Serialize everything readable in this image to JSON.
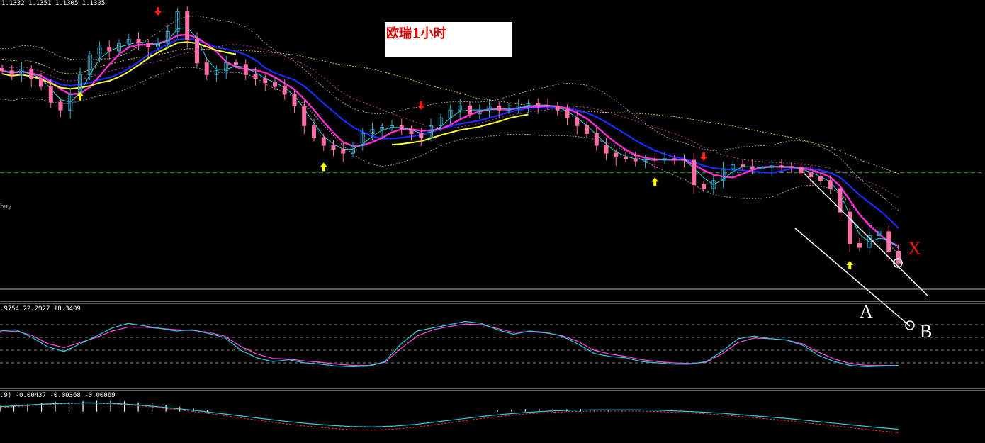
{
  "header": {
    "ohlc_readout": "1.1332 1.1351 1.1305 1.1305",
    "title": "欧瑞1小时",
    "buy_label": "buy"
  },
  "indicator1": {
    "readout": ".9754 22.2927 18.3409"
  },
  "indicator2": {
    "readout": ".9) -0.00437 -0.00368 -0.00069"
  },
  "annotations": {
    "A": "A",
    "B": "B",
    "X": "X"
  },
  "colors": {
    "background": "#000000",
    "bull_candle": "#2aa8c8",
    "bear_candle": "#ff6fa8",
    "ma_blue": "#1a2cff",
    "ma_magenta": "#ff2cd6",
    "ma_yellow": "#ffff33",
    "ma_cyan": "#22d6e8",
    "envelope": "#c8c8c8",
    "buy_line": "#22aa22",
    "up_arrow": "#ffff00",
    "down_arrow": "#ff1a1a",
    "stoch_main": "#2ad0e0",
    "stoch_signal": "#ff4ce0",
    "macd_hist": "#ffffff",
    "macd_signal": "#ff3030",
    "macd_line": "#2ad0e0"
  },
  "chart_data": [
    {
      "type": "candlestick",
      "title": "欧瑞1小时",
      "ylim": [
        1.127,
        1.164
      ],
      "horizontal_line": {
        "label": "buy",
        "value": 1.142
      },
      "series": [
        {
          "name": "price",
          "close": [
            1.155,
            1.1545,
            1.1552,
            1.154,
            1.153,
            1.151,
            1.15,
            1.152,
            1.1545,
            1.157,
            1.158,
            1.1575,
            1.1585,
            1.159,
            1.1585,
            1.158,
            1.1585,
            1.16,
            1.1625,
            1.159,
            1.156,
            1.1545,
            1.155,
            1.156,
            1.1558,
            1.1545,
            1.154,
            1.1535,
            1.153,
            1.152,
            1.1505,
            1.148,
            1.1465,
            1.1455,
            1.145,
            1.1445,
            1.1455,
            1.147,
            1.1475,
            1.1478,
            1.148,
            1.1475,
            1.147,
            1.1465,
            1.148,
            1.149,
            1.15,
            1.1505,
            1.1495,
            1.15,
            1.1505,
            1.15,
            1.1502,
            1.1505,
            1.1508,
            1.1506,
            1.1505,
            1.15,
            1.149,
            1.148,
            1.147,
            1.1455,
            1.1445,
            1.144,
            1.1438,
            1.1435,
            1.1437,
            1.1436,
            1.1438,
            1.1437,
            1.1436,
            1.1405,
            1.14,
            1.141,
            1.1425,
            1.143,
            1.1428,
            1.1425,
            1.1427,
            1.1429,
            1.1428,
            1.1427,
            1.142,
            1.1415,
            1.141,
            1.14,
            1.137,
            1.133,
            1.1325,
            1.134,
            1.1345,
            1.132,
            1.1305
          ]
        }
      ]
    },
    {
      "type": "line",
      "title": "",
      "ylim": [
        0,
        100
      ],
      "grid_levels": [
        80,
        60,
        40,
        20
      ],
      "series": [
        {
          "name": "",
          "values": [
            70,
            72,
            60,
            45,
            38,
            50,
            62,
            75,
            82,
            78,
            74,
            70,
            72,
            66,
            60,
            40,
            28,
            22,
            25,
            20,
            18,
            15,
            14,
            15,
            22,
            50,
            70,
            75,
            80,
            85,
            82,
            72,
            65,
            70,
            68,
            62,
            50,
            35,
            30,
            28,
            22,
            20,
            18,
            18,
            22,
            38,
            58,
            62,
            58,
            56,
            48,
            32,
            22,
            16,
            14,
            15,
            16
          ]
        },
        {
          "name": "",
          "values": [
            68,
            70,
            63,
            50,
            44,
            52,
            60,
            70,
            76,
            76,
            74,
            72,
            71,
            68,
            62,
            46,
            34,
            27,
            26,
            23,
            21,
            18,
            16,
            16,
            21,
            43,
            62,
            72,
            77,
            81,
            80,
            74,
            68,
            69,
            67,
            63,
            54,
            40,
            34,
            30,
            25,
            22,
            20,
            19,
            21,
            34,
            52,
            59,
            58,
            56,
            50,
            37,
            26,
            19,
            16,
            16,
            16
          ]
        }
      ]
    },
    {
      "type": "bar",
      "title": "",
      "ylim": [
        -0.006,
        0.003
      ],
      "series": [
        {
          "name": "histogram",
          "values": [
            0.0012,
            0.0014,
            0.0016,
            0.0018,
            0.002,
            0.002,
            0.0021,
            0.0022,
            0.0022,
            0.0021,
            0.0019,
            0.0017,
            0.0014,
            0.001,
            0.0006,
            0.0003,
            0.0,
            -0.0004,
            -0.0008,
            -0.0012,
            -0.0016,
            -0.002,
            -0.0024,
            -0.0026,
            -0.0028,
            -0.003,
            -0.0032,
            -0.0033,
            -0.0033,
            -0.0031,
            -0.0027,
            -0.0022,
            -0.0016,
            -0.001,
            -0.0005,
            -0.0001,
            0.0002,
            0.0004,
            0.0005,
            0.0006,
            0.0006,
            0.0005,
            0.0005,
            0.0004,
            0.0003,
            0.0002,
            0.0001,
            -0.0001,
            -0.0003,
            -0.0005,
            -0.0007,
            -0.001,
            -0.0013,
            -0.0016,
            -0.0018,
            -0.002,
            -0.0023,
            -0.0025,
            -0.0028,
            -0.0031,
            -0.0034,
            -0.0037,
            -0.004,
            -0.0042,
            -0.0043,
            -0.0044
          ]
        },
        {
          "name": "signal",
          "values": [
            0.0011,
            0.0014,
            0.0017,
            0.0019,
            0.002,
            0.0019,
            0.0016,
            0.0012,
            0.0007,
            0.0002,
            -0.0004,
            -0.001,
            -0.0016,
            -0.0022,
            -0.0027,
            -0.0031,
            -0.0034,
            -0.0035,
            -0.0033,
            -0.0029,
            -0.0023,
            -0.0017,
            -0.0011,
            -0.0006,
            -0.0002,
            0.0001,
            0.0003,
            0.0004,
            0.0004,
            0.0004,
            0.0003,
            0.0001,
            -0.0001,
            -0.0004,
            -0.0008,
            -0.0012,
            -0.0016,
            -0.0021,
            -0.0026,
            -0.0031,
            -0.0036,
            -0.004
          ]
        }
      ]
    }
  ]
}
